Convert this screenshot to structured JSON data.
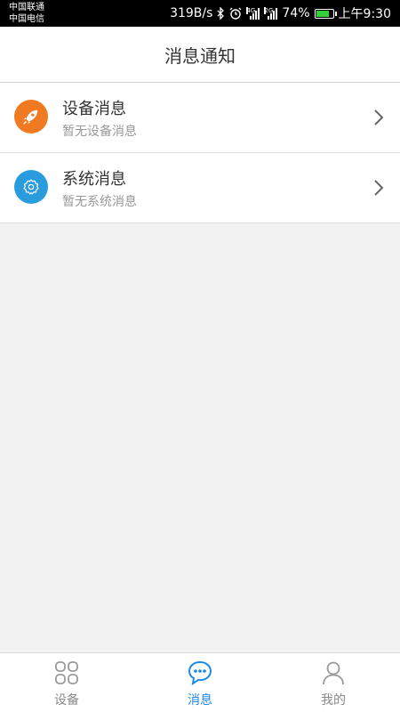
{
  "status_bar": {
    "carrier_1": "中国联通",
    "carrier_2": "中国电信",
    "net_speed": "319B/s",
    "sim1_gen": "4G",
    "sim2_gen": "2G",
    "battery": "74%",
    "battery_level": 0.74,
    "time": "上午9:30"
  },
  "header": {
    "title": "消息通知"
  },
  "messages": [
    {
      "title": "设备消息",
      "subtitle": "暂无设备消息",
      "icon": "rocket-icon",
      "color": "#f07a22"
    },
    {
      "title": "系统消息",
      "subtitle": "暂无系统消息",
      "icon": "gear-icon",
      "color": "#2a9cde"
    }
  ],
  "tabs": [
    {
      "label": "设备",
      "icon": "grid-icon",
      "active": false
    },
    {
      "label": "消息",
      "icon": "chat-bubble-icon",
      "active": true
    },
    {
      "label": "我的",
      "icon": "user-icon",
      "active": false
    }
  ],
  "colors": {
    "accent": "#1e88e5",
    "inactive": "#888888"
  }
}
